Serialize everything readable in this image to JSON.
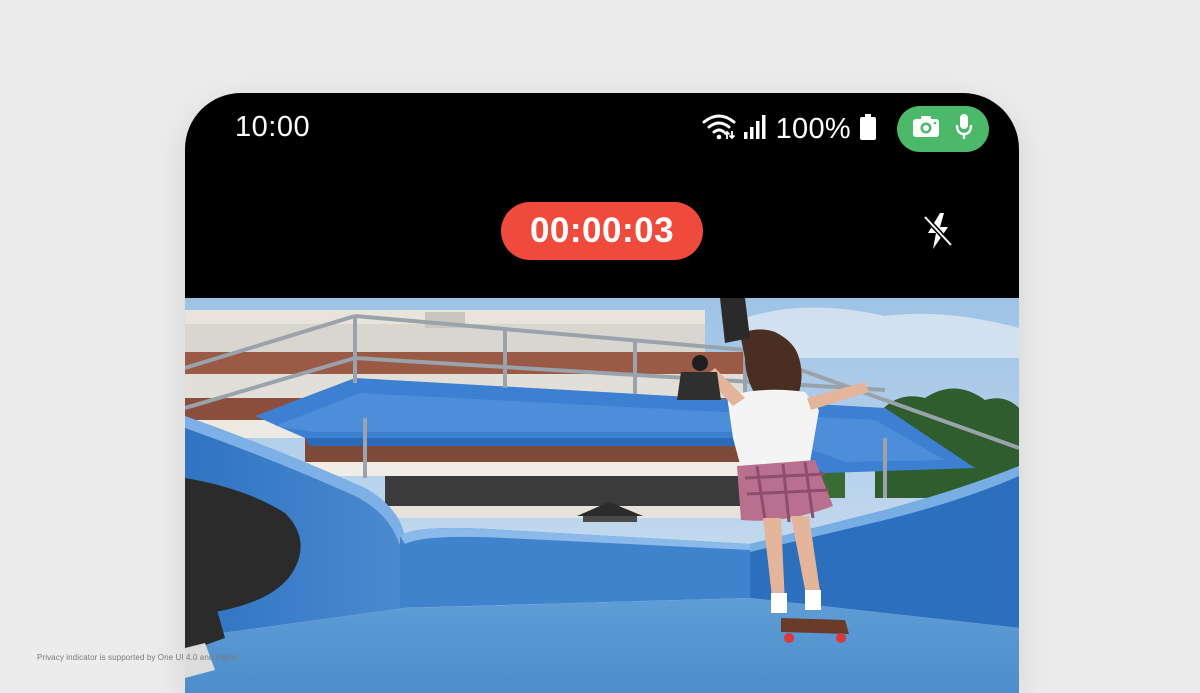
{
  "status_bar": {
    "time": "10:00",
    "battery_percent": "100%",
    "icons": [
      "wifi-icon",
      "signal-icon",
      "battery-icon",
      "camera-icon",
      "microphone-icon"
    ],
    "privacy_indicator_color": "#4cb86a"
  },
  "camera": {
    "recording_timer": "00:00:03",
    "recording_timer_color": "#f04a3c",
    "flash_icon": "flash-off-icon"
  },
  "footnote": "Privacy indicator is supported by One UI 4.0 and higher."
}
